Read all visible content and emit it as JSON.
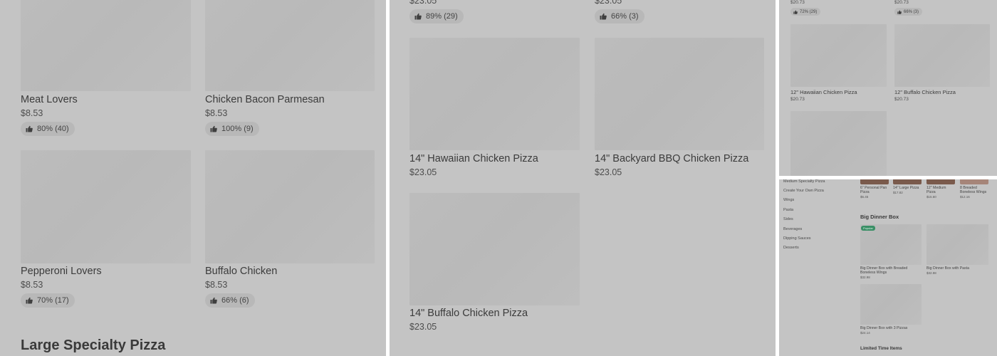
{
  "panel1": {
    "items": [
      {
        "name": "Meat Lovers",
        "price": "$8.53",
        "rating": "80% (40)"
      },
      {
        "name": "Chicken Bacon Parmesan",
        "price": "$8.53",
        "rating": "100% (9)"
      },
      {
        "name": "Pepperoni Lovers",
        "price": "$8.53",
        "rating": "70% (17)"
      },
      {
        "name": "Buffalo Chicken",
        "price": "$8.53",
        "rating": "66% (6)"
      }
    ],
    "section_title": "Large Specialty Pizza"
  },
  "panel2": {
    "top": [
      {
        "price": "$23.05",
        "rating": "89% (29)"
      },
      {
        "price": "$23.05",
        "rating": "66% (3)"
      }
    ],
    "items": [
      {
        "name": "14\" Hawaiian Chicken Pizza",
        "price": "$23.05"
      },
      {
        "name": "14\" Backyard BBQ Chicken Pizza",
        "price": "$23.05"
      },
      {
        "name": "14\" Buffalo Chicken Pizza",
        "price": "$23.05"
      }
    ]
  },
  "panel3": {
    "top": [
      {
        "price": "$20.73",
        "rating": "72% (29)"
      },
      {
        "price": "$20.73",
        "rating": "66% (3)"
      }
    ],
    "items": [
      {
        "name": "12\" Hawaiian Chicken Pizza",
        "price": "$20.73"
      },
      {
        "name": "12\" Buffalo Chicken Pizza",
        "price": "$20.73"
      }
    ]
  },
  "panel4": {
    "sidebar": [
      "Medium Specialty Pizza",
      "Create Your Own Pizza",
      "Wings",
      "Pasta",
      "Sides",
      "Beverages",
      "Dipping Sauces",
      "Desserts"
    ],
    "strip": [
      {
        "name": "6\" Personal Pan Pizza",
        "price": "$6.45"
      },
      {
        "name": "14\" Large Pizza",
        "price": "$17.82"
      },
      {
        "name": "12\" Medium Pizza",
        "price": "$15.60"
      },
      {
        "name": "8 Breaded Boneless Wings",
        "price": "$12.16"
      }
    ],
    "section_title": "Big Dinner Box",
    "badge": "Popular",
    "items": [
      {
        "name": "Big Dinner Box with Breaded Boneless Wings",
        "price": "$32.98"
      },
      {
        "name": "Big Dinner Box with Pasta",
        "price": "$32.98"
      },
      {
        "name": "Big Dinner Box with 3 Pizzas",
        "price": "$24.14"
      }
    ],
    "next_section": "Limited Time Items"
  }
}
